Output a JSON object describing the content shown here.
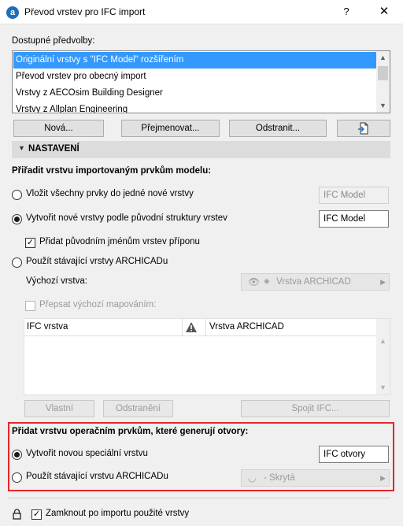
{
  "window": {
    "title": "Převod vrstev pro IFC import",
    "help_glyph": "?",
    "close_glyph": "✕",
    "app_icon_glyph": "a"
  },
  "presets": {
    "heading": "Dostupné předvolby:",
    "items": [
      "Originální vrstvy s \"IFC Model\" rozšířením",
      "Převod vrstev pro obecný import",
      "Vrstvy z AECOsim Building Designer",
      "Vrstvy z Allplan Engineering"
    ],
    "selected_index": 0
  },
  "buttons": {
    "new": "Nová...",
    "rename": "Přejmenovat...",
    "delete": "Odstranit..."
  },
  "section": {
    "title": "NASTAVENÍ"
  },
  "assign": {
    "heading": "Přiřadit vrstvu importovaným prvkům modelu:",
    "opt_single": "Vložit všechny prvky do jedné nové vrstvy",
    "opt_single_value": "IFC Model",
    "opt_structure": "Vytvořit nové vrstvy podle původní struktury vrstev",
    "opt_structure_value": "IFC Model",
    "add_suffix": "Přidat původním jménům vrstev příponu",
    "opt_existing": "Použít stávající vrstvy ARCHICADu",
    "default_layer_label": "Výchozí vrstva:",
    "default_layer_value": "Vrstva ARCHICAD",
    "override_label": "Přepsat výchozí mapováním:",
    "table": {
      "col_ifc": "IFC vrstva",
      "col_archicad": "Vrstva ARCHICAD"
    },
    "btn_custom": "Vlastní",
    "btn_remove": "Odstranění",
    "btn_merge": "Spojit IFC..."
  },
  "openings": {
    "heading": "Přidat vrstvu operačním prvkům, které generují otvory:",
    "opt_new": "Vytvořit novou speciální vrstvu",
    "opt_new_value": "IFC otvory",
    "opt_existing": "Použít stávající vrstvu ARCHICADu",
    "opt_existing_value": "- Skrytá"
  },
  "footer": {
    "lock_label": "Zamknout po importu použité vrstvy"
  },
  "colors": {
    "selection": "#3399ff",
    "highlight_border": "#e3262c"
  }
}
